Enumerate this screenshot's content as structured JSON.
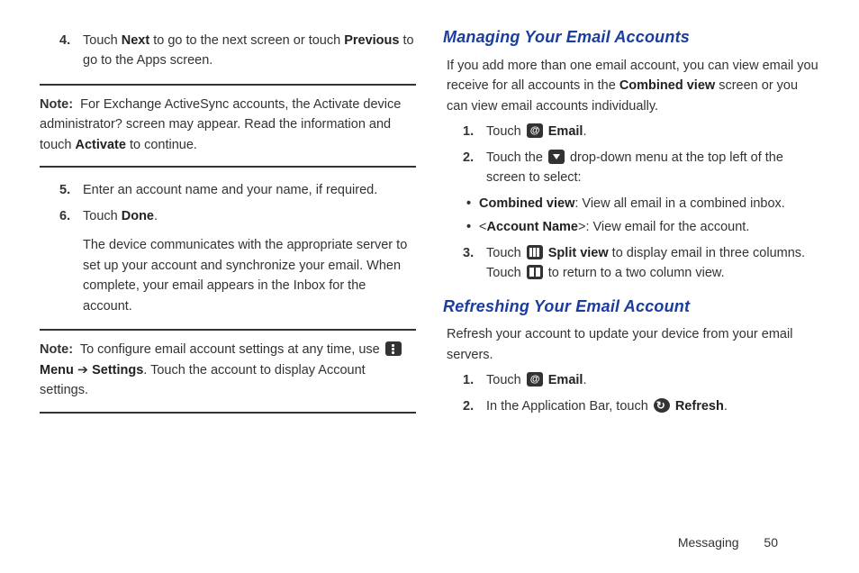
{
  "left": {
    "step4": {
      "num": "4.",
      "pre": "Touch ",
      "b1": "Next",
      "mid": " to go to the next screen or touch ",
      "b2": "Previous",
      "post": " to go to the Apps screen."
    },
    "note1": {
      "label": "Note:",
      "pre": " For Exchange ActiveSync accounts, the Activate device administrator?  screen may appear. Read the information and touch ",
      "b": "Activate",
      "post": " to continue."
    },
    "step5": {
      "num": "5.",
      "text": "Enter an account name and your name, if required."
    },
    "step6": {
      "num": "6.",
      "pre": "Touch ",
      "b": "Done",
      "post": ".",
      "para2": "The device communicates with the appropriate server to set up your account and synchronize your email. When complete, your email appears in the Inbox for the account."
    },
    "note2": {
      "label": "Note:",
      "pre": " To configure email account settings at any time, use ",
      "b1": "Menu",
      "arrow": " ➔ ",
      "b2": "Settings",
      "post": ". Touch the account to display Account settings."
    }
  },
  "right": {
    "h1": "Managing Your Email Accounts",
    "intro": {
      "pre": "If you add more than one email account, you can view email you receive for all accounts in the ",
      "b": "Combined view",
      "post": " screen or you can view email accounts individually."
    },
    "m1": {
      "num": "1.",
      "pre": "Touch ",
      "b": "Email",
      "post": "."
    },
    "m2": {
      "num": "2.",
      "pre": "Touch the ",
      "post": " drop-down menu at the top left of the screen to select:"
    },
    "bul1": {
      "dot": "•",
      "b": "Combined view",
      "post": ": View all email in a combined inbox."
    },
    "bul2": {
      "dot": "•",
      "pre": " <",
      "b": "Account Name",
      "post": ">: View email for the account."
    },
    "m3": {
      "num": "3.",
      "pre": "Touch ",
      "b": "Split view",
      "mid": " to display email in three columns. Touch ",
      "post": " to return to a two column view."
    },
    "h2": "Refreshing Your Email Account",
    "refresh_intro": "Refresh your account to update your device from your email servers.",
    "r1": {
      "num": "1.",
      "pre": "Touch ",
      "b": "Email",
      "post": "."
    },
    "r2": {
      "num": "2.",
      "pre": "In the Application Bar, touch ",
      "b": "Refresh",
      "post": "."
    }
  },
  "footer": {
    "section": "Messaging",
    "page": "50"
  }
}
